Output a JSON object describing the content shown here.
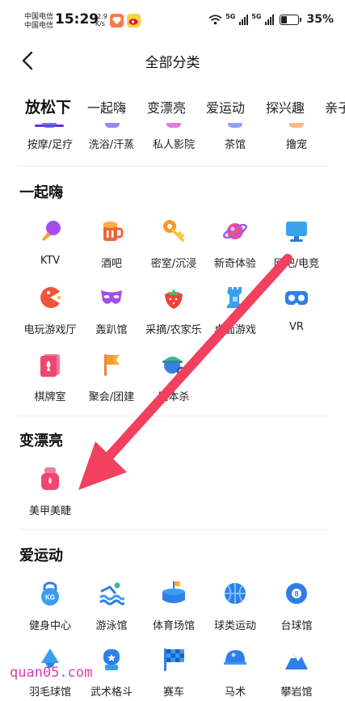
{
  "status_bar": {
    "carrier_1": "中国电信",
    "carrier_2": "中国电信",
    "time": "15:29",
    "speed_value": "12.9",
    "speed_unit": "K/s",
    "net_1": "5G",
    "net_2": "5G",
    "battery": "35%",
    "battery_level": 0.35
  },
  "header": {
    "title": "全部分类"
  },
  "tabs": [
    "放松下",
    "一起嗨",
    "变漂亮",
    "爱运动",
    "探兴趣",
    "亲子"
  ],
  "relax_row": [
    "按摩/足疗",
    "洗浴/汗蒸",
    "私人影院",
    "茶馆",
    "撸宠"
  ],
  "sections": [
    {
      "title": "一起嗨",
      "items": [
        {
          "label": "KTV",
          "icon": "microphone-icon"
        },
        {
          "label": "酒吧",
          "icon": "beer-icon"
        },
        {
          "label": "密室/沉浸",
          "icon": "key-icon"
        },
        {
          "label": "新奇体验",
          "icon": "planet-icon"
        },
        {
          "label": "网吧/电竞",
          "icon": "monitor-icon"
        },
        {
          "label": "电玩游戏厅",
          "icon": "pacman-icon"
        },
        {
          "label": "轰趴馆",
          "icon": "party-mask-icon"
        },
        {
          "label": "采摘/农家乐",
          "icon": "strawberry-icon"
        },
        {
          "label": "桌面游戏",
          "icon": "chess-rook-icon"
        },
        {
          "label": "VR",
          "icon": "vr-headset-icon"
        },
        {
          "label": "棋牌室",
          "icon": "playing-card-icon"
        },
        {
          "label": "聚会/团建",
          "icon": "flag-icon"
        },
        {
          "label": "剧本杀",
          "icon": "detective-icon"
        }
      ]
    },
    {
      "title": "变漂亮",
      "items": [
        {
          "label": "美甲美睫",
          "icon": "nail-polish-icon"
        }
      ]
    },
    {
      "title": "爱运动",
      "items": [
        {
          "label": "健身中心",
          "icon": "kettlebell-icon"
        },
        {
          "label": "游泳馆",
          "icon": "swimming-icon"
        },
        {
          "label": "体育场馆",
          "icon": "stadium-icon"
        },
        {
          "label": "球类运动",
          "icon": "basketball-icon"
        },
        {
          "label": "台球馆",
          "icon": "billiard-ball-icon"
        },
        {
          "label": "羽毛球馆",
          "icon": "shuttlecock-icon"
        },
        {
          "label": "武术格斗",
          "icon": "boxing-glove-icon"
        },
        {
          "label": "赛车",
          "icon": "checkered-flag-icon"
        },
        {
          "label": "马术",
          "icon": "riding-helmet-icon"
        },
        {
          "label": "攀岩馆",
          "icon": "mountain-icon"
        }
      ]
    }
  ],
  "watermark": "quan05.com",
  "colors": {
    "accent": "#6a2dd4",
    "arrow": "#f2405f",
    "watermark": "#d63fae"
  }
}
